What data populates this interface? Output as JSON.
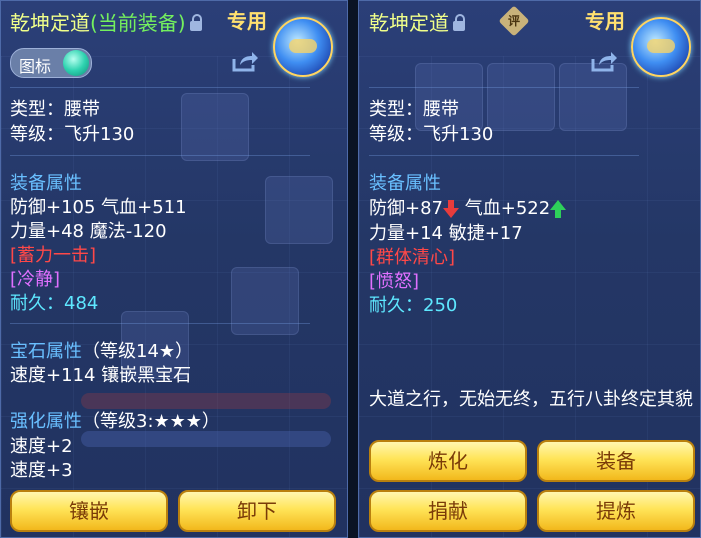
{
  "left": {
    "title": "乾坤定道",
    "title_suffix": "(当前装备)",
    "exclusive": "专用",
    "icon_toggle_label": "图标",
    "type_line": "类型：腰带",
    "level_line": "等级：飞升130",
    "equip_header": "装备属性",
    "attr_line1": "防御+105 气血+511",
    "attr_line2": "力量+48 魔法-120",
    "special1": "[蓄力一击]",
    "special2": "[冷静]",
    "durability_label": "耐久：",
    "durability_value": "484",
    "gem_header": "宝石属性",
    "gem_level": "（等级14★）",
    "gem_line": "速度+114 镶嵌黑宝石",
    "enhance_header": "强化属性",
    "enhance_level": "（等级3:★★★）",
    "enhance_line1": "速度+2",
    "enhance_line2": "速度+3",
    "buttons": [
      "镶嵌",
      "卸下"
    ]
  },
  "right": {
    "title": "乾坤定道",
    "rate_icon": "评",
    "exclusive": "专用",
    "type_line": "类型：腰带",
    "level_line": "等级：飞升130",
    "equip_header": "装备属性",
    "attr_defense": "防御+87",
    "attr_hp": "气血+522",
    "attr_line2": "力量+14 敏捷+17",
    "special1": "[群体清心]",
    "special2": "[愤怒]",
    "durability_label": "耐久：",
    "durability_value": "250",
    "description": "大道之行，无始无终，五行八卦终定其貌",
    "buttons": [
      "炼化",
      "装备",
      "捐献",
      "提炼"
    ]
  },
  "colors": {
    "title": "#f0ff8a",
    "current_equipped": "#74f05e",
    "header": "#69bfff",
    "special_red": "#ff4848",
    "special_pink": "#e070ff",
    "durability": "#5ee8ff",
    "button_gold": "#ffe458",
    "stat_down": "#e83c3c",
    "stat_up": "#2ed05a"
  },
  "icons": {
    "lock": "lock-icon",
    "share": "share-icon",
    "rate": "rate-icon",
    "item": "belt-item-icon",
    "stat_down": "arrow-down-icon",
    "stat_up": "arrow-up-icon"
  }
}
